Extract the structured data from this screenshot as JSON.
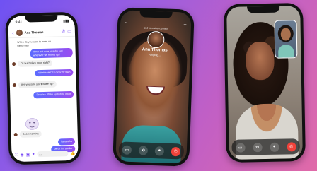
{
  "chat_phone": {
    "status_time": "9:41",
    "contact_name": "Ana Thomas",
    "messages": [
      {
        "from": "in",
        "text": "When do you want to meet up tomorrow?"
      },
      {
        "from": "out",
        "text": "Hmm not sure, maybe just wherever we ended up?"
      },
      {
        "from": "in",
        "text": "Ok but before noon right?"
      },
      {
        "from": "out",
        "text": "Hahaha ok I'll 8 diner by then"
      },
      {
        "from": "in",
        "text": "Are you sure you'll wake up?"
      },
      {
        "from": "out",
        "text": "Promise. I'll be up before noon"
      },
      {
        "from": "in",
        "text": "Good morning"
      },
      {
        "from": "out",
        "text": "hahahaha"
      },
      {
        "from": "out",
        "text": "ok ok I'm awake"
      }
    ],
    "composer_placeholder": "Aa",
    "accent": "#7a4cf5"
  },
  "voice_call_phone": {
    "header": "End-to-end encrypted",
    "caller_name": "Ana Thomas",
    "caller_status": "Ringing..."
  },
  "video_call_phone": {},
  "controls": {
    "video_icon": "video-icon",
    "camera_flip_icon": "camera-flip-icon",
    "mic_icon": "microphone-icon",
    "end_icon": "end-call-icon",
    "end_color": "#f0423a"
  }
}
